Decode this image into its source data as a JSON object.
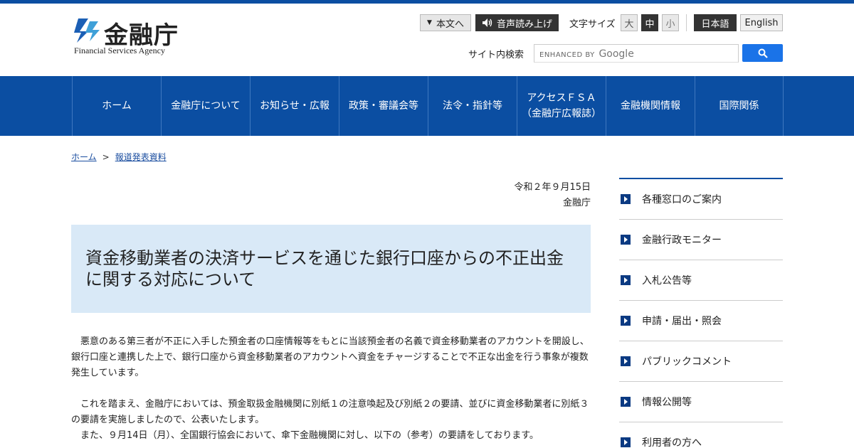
{
  "header": {
    "logo_kanji": "金融庁",
    "logo_en": "Financial Services Agency",
    "skip_label": "本文へ",
    "voice_label": "音声読み上げ",
    "font_size_label": "文字サイズ",
    "font_sizes": [
      "大",
      "中",
      "小"
    ],
    "lang_ja": "日本語",
    "lang_en": "English",
    "search_label": "サイト内検索",
    "search_placeholder_prefix": "ENHANCED BY",
    "search_placeholder_brand": "Google"
  },
  "nav": [
    {
      "label": "ホーム"
    },
    {
      "label": "金融庁について"
    },
    {
      "label": "お知らせ・広報"
    },
    {
      "label": "政策・審議会等"
    },
    {
      "label": "法令・指針等"
    },
    {
      "label": "アクセスＦＳＡ\n（金融庁広報誌）"
    },
    {
      "label": "金融機関情報"
    },
    {
      "label": "国際関係"
    }
  ],
  "breadcrumb": {
    "home": "ホーム",
    "separator": ">",
    "current": "報道発表資料"
  },
  "article": {
    "date": "令和２年９月15日",
    "org": "金融庁",
    "title": "資金移動業者の決済サービスを通じた銀行口座からの不正出金に関する対応について",
    "para1": "　悪意のある第三者が不正に入手した預金者の口座情報等をもとに当該預金者の名義で資金移動業者のアカウントを開設し、銀行口座と連携した上で、銀行口座から資金移動業者のアカウントへ資金をチャージすることで不正な出金を行う事象が複数発生しています。",
    "para2": "　これを踏まえ、金融庁においては、預金取扱金融機関に別紙１の注意喚起及び別紙２の要請、並びに資金移動業者に別紙３の要請を実施しましたので、公表いたします。",
    "para3": "　また、９月14日（月）、全国銀行協会において、傘下金融機関に対し、以下の（参考）の要請をしております。"
  },
  "sidebar": [
    {
      "label": "各種窓口のご案内"
    },
    {
      "label": "金融行政モニター"
    },
    {
      "label": "入札公告等"
    },
    {
      "label": "申請・届出・照会"
    },
    {
      "label": "パブリックコメント"
    },
    {
      "label": "情報公開等"
    },
    {
      "label": "利用者の方へ"
    }
  ],
  "colors": {
    "brand_blue": "#0b4ea2",
    "title_bg": "#d9e9f7",
    "search_button": "#1a73e8"
  }
}
